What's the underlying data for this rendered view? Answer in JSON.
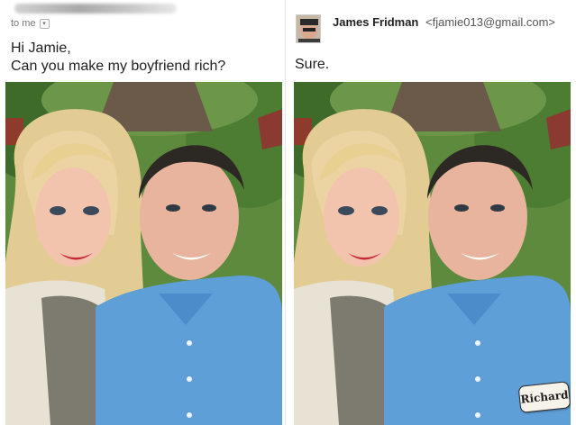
{
  "left": {
    "recipient_label": "to me",
    "dropdown_glyph": "▾",
    "message_lines": [
      "Hi Jamie,",
      "Can you make my boyfriend rich?"
    ]
  },
  "right": {
    "sender_name": "James Fridman",
    "sender_email": "<fjamie013@gmail.com>",
    "reply": "Sure.",
    "name_tag": "Richard"
  },
  "colors": {
    "shirt_blue": "#5f9fd8",
    "foliage_green": "#4f7a33",
    "hair_blonde": "#e6cf96"
  },
  "icons": [
    "dropdown-chevron-icon",
    "avatar-photo"
  ]
}
